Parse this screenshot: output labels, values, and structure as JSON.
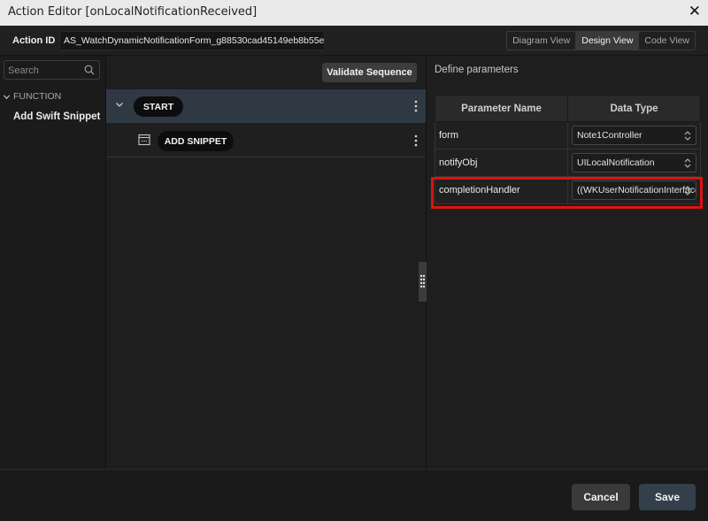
{
  "window": {
    "title": "Action Editor [onLocalNotificationReceived]"
  },
  "action_id": {
    "label": "Action ID",
    "value": "AS_WatchDynamicNotificationForm_g88530cad45149eb8b55e"
  },
  "view_tabs": [
    {
      "label": "Diagram View",
      "active": false
    },
    {
      "label": "Design View",
      "active": true
    },
    {
      "label": "Code View",
      "active": false
    }
  ],
  "sidebar": {
    "search_placeholder": "Search",
    "group_label": "FUNCTION",
    "items": [
      {
        "label": "Add Swift Snippet"
      }
    ]
  },
  "sequence": {
    "validate_label": "Validate Sequence",
    "start_label": "START",
    "snippet_label": "ADD SNIPPET"
  },
  "parameters": {
    "header": "Define parameters",
    "col_name": "Parameter Name",
    "col_type": "Data Type",
    "rows": [
      {
        "name": "form",
        "type": "Note1Controller"
      },
      {
        "name": "notifyObj",
        "type": "UILocalNotification"
      },
      {
        "name": "completionHandler",
        "type": "((WKUserNotificationInterfaceType) -> Void)"
      }
    ]
  },
  "footer": {
    "cancel_label": "Cancel",
    "save_label": "Save"
  },
  "colors": {
    "highlight": "#e01111",
    "start_row": "#2e3943",
    "save_button": "#33404b"
  },
  "icons": [
    "close-icon",
    "search-icon",
    "chevron-down-icon",
    "kebab-menu-icon",
    "snippet-icon",
    "drag-handle-icon",
    "select-arrows-icon"
  ]
}
